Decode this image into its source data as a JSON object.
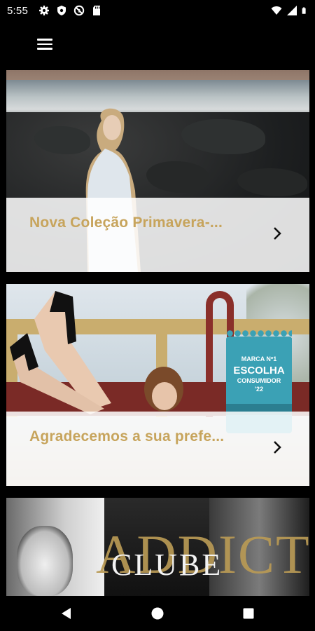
{
  "status_bar": {
    "time": "5:55",
    "left_icons": [
      "gear-icon",
      "shield-icon",
      "blocked-icon",
      "sd-card-icon"
    ],
    "right_icons": [
      "wifi-icon",
      "signal-icon",
      "battery-icon"
    ]
  },
  "app_bar": {
    "menu_icon": "hamburger-menu-icon"
  },
  "cards": [
    {
      "title": "Nova Coleção Primavera-...",
      "chevron": "chevron-right-icon"
    },
    {
      "title": "Agradecemos a sua prefe...",
      "chevron": "chevron-right-icon",
      "badge": {
        "line1": "MARCA Nº1",
        "line2": "ESCOLHA",
        "line3": "CONSUMIDOR",
        "line4": "'22"
      }
    },
    {
      "image_text_1": "ADDICT",
      "image_text_2": "CLUBE"
    }
  ],
  "nav_bar": {
    "back": "back-triangle-icon",
    "home": "home-circle-icon",
    "recents": "recents-square-icon"
  },
  "colors": {
    "title_gold": "#c7a45c",
    "overlay": "#ffffff",
    "badge": "#3ba1b5"
  }
}
